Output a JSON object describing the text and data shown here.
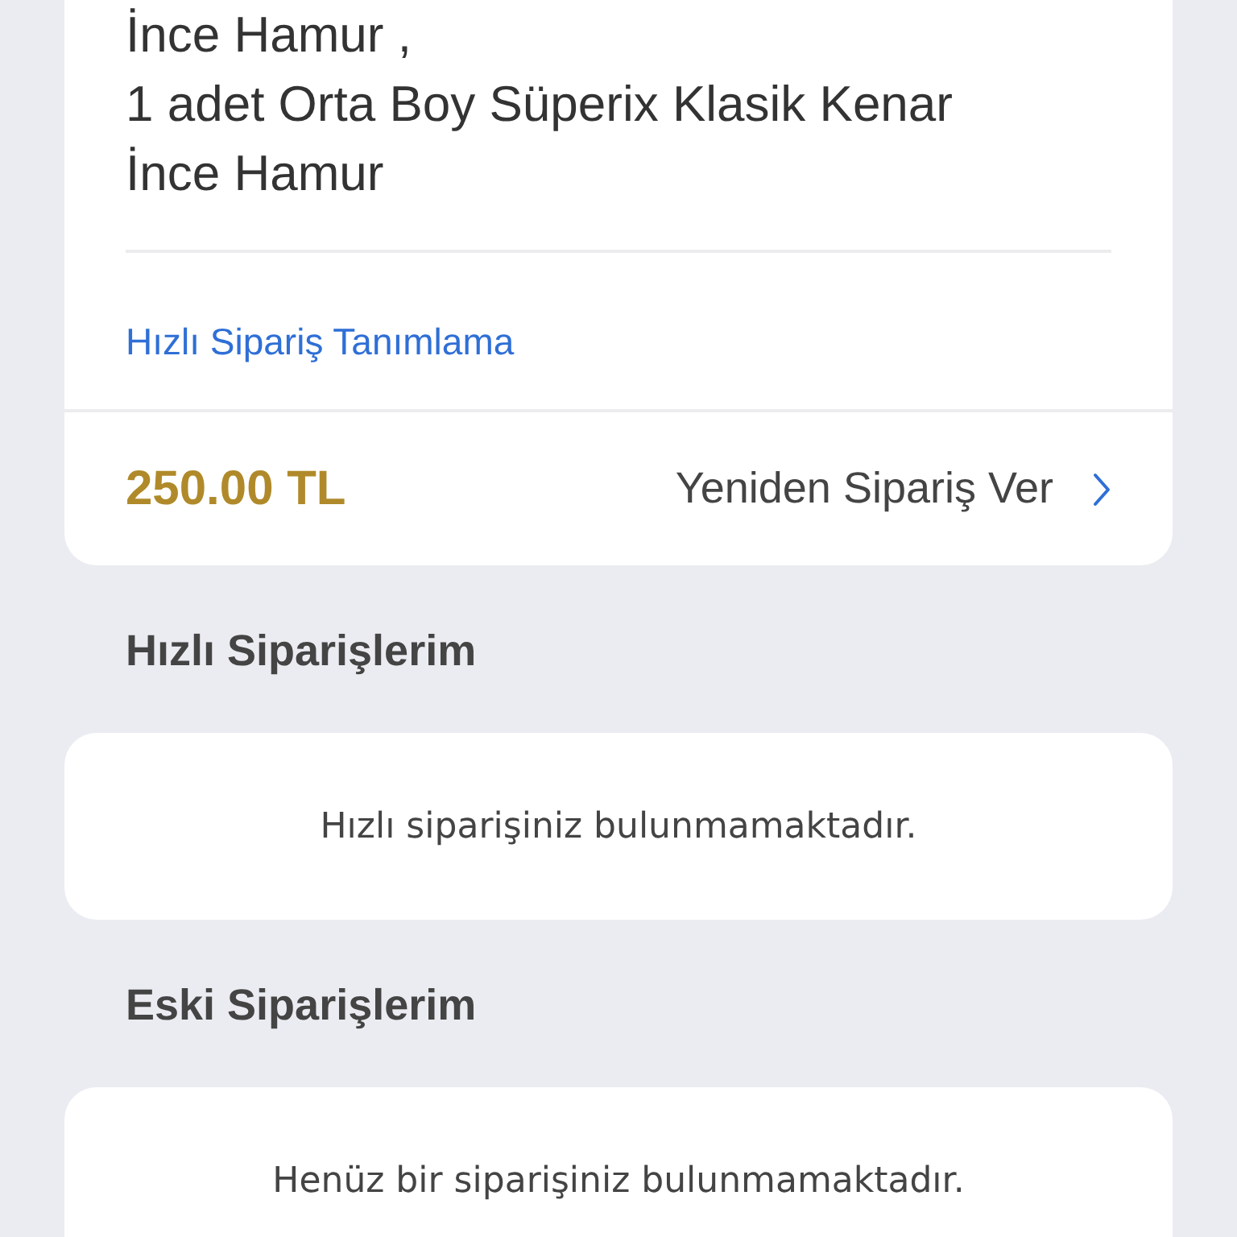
{
  "order_card": {
    "description": "İnce Hamur ,\n1 adet Orta Boy Süperix Klasik Kenar\nİnce Hamur",
    "quick_order_link": "Hızlı Sipariş Tanımlama",
    "price": "250.00 TL",
    "reorder_link": "Yeniden Sipariş Ver"
  },
  "sections": [
    {
      "title": "Hızlı Siparişlerim",
      "empty_message": "Hızlı siparişiniz bulunmamaktadır."
    },
    {
      "title": "Eski Siparişlerim",
      "empty_message": "Henüz bir siparişiniz bulunmamaktadır."
    }
  ]
}
